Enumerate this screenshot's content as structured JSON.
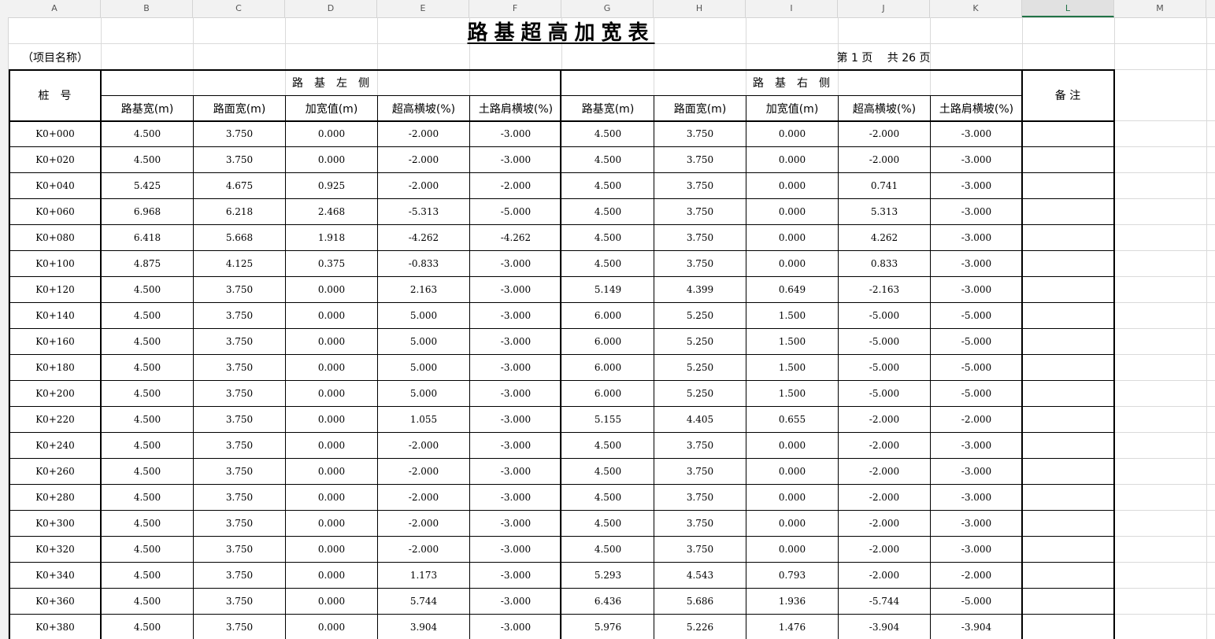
{
  "column_letters": [
    "A",
    "B",
    "C",
    "D",
    "E",
    "F",
    "G",
    "H",
    "I",
    "J",
    "K",
    "L",
    "M"
  ],
  "selected_column": "L",
  "title": "路基超高加宽表",
  "project_name": "（项目名称）",
  "page_info": "第 1 页　 共 26 页",
  "headers": {
    "station": "桩　号",
    "left_group": "路　基　左　侧",
    "right_group": "路　基　右　侧",
    "remarks": "备 注",
    "left_cols": [
      "路基宽(m)",
      "路面宽(m)",
      "加宽值(m)",
      "超高横坡(%)",
      "土路肩横坡(%)"
    ],
    "right_cols": [
      "路基宽(m)",
      "路面宽(m)",
      "加宽值(m)",
      "超高横坡(%)",
      "土路肩横坡(%)"
    ]
  },
  "rows": [
    [
      "K0+000",
      "4.500",
      "3.750",
      "0.000",
      "-2.000",
      "-3.000",
      "4.500",
      "3.750",
      "0.000",
      "-2.000",
      "-3.000",
      ""
    ],
    [
      "K0+020",
      "4.500",
      "3.750",
      "0.000",
      "-2.000",
      "-3.000",
      "4.500",
      "3.750",
      "0.000",
      "-2.000",
      "-3.000",
      ""
    ],
    [
      "K0+040",
      "5.425",
      "4.675",
      "0.925",
      "-2.000",
      "-2.000",
      "4.500",
      "3.750",
      "0.000",
      "0.741",
      "-3.000",
      ""
    ],
    [
      "K0+060",
      "6.968",
      "6.218",
      "2.468",
      "-5.313",
      "-5.000",
      "4.500",
      "3.750",
      "0.000",
      "5.313",
      "-3.000",
      ""
    ],
    [
      "K0+080",
      "6.418",
      "5.668",
      "1.918",
      "-4.262",
      "-4.262",
      "4.500",
      "3.750",
      "0.000",
      "4.262",
      "-3.000",
      ""
    ],
    [
      "K0+100",
      "4.875",
      "4.125",
      "0.375",
      "-0.833",
      "-3.000",
      "4.500",
      "3.750",
      "0.000",
      "0.833",
      "-3.000",
      ""
    ],
    [
      "K0+120",
      "4.500",
      "3.750",
      "0.000",
      "2.163",
      "-3.000",
      "5.149",
      "4.399",
      "0.649",
      "-2.163",
      "-3.000",
      ""
    ],
    [
      "K0+140",
      "4.500",
      "3.750",
      "0.000",
      "5.000",
      "-3.000",
      "6.000",
      "5.250",
      "1.500",
      "-5.000",
      "-5.000",
      ""
    ],
    [
      "K0+160",
      "4.500",
      "3.750",
      "0.000",
      "5.000",
      "-3.000",
      "6.000",
      "5.250",
      "1.500",
      "-5.000",
      "-5.000",
      ""
    ],
    [
      "K0+180",
      "4.500",
      "3.750",
      "0.000",
      "5.000",
      "-3.000",
      "6.000",
      "5.250",
      "1.500",
      "-5.000",
      "-5.000",
      ""
    ],
    [
      "K0+200",
      "4.500",
      "3.750",
      "0.000",
      "5.000",
      "-3.000",
      "6.000",
      "5.250",
      "1.500",
      "-5.000",
      "-5.000",
      ""
    ],
    [
      "K0+220",
      "4.500",
      "3.750",
      "0.000",
      "1.055",
      "-3.000",
      "5.155",
      "4.405",
      "0.655",
      "-2.000",
      "-2.000",
      ""
    ],
    [
      "K0+240",
      "4.500",
      "3.750",
      "0.000",
      "-2.000",
      "-3.000",
      "4.500",
      "3.750",
      "0.000",
      "-2.000",
      "-3.000",
      ""
    ],
    [
      "K0+260",
      "4.500",
      "3.750",
      "0.000",
      "-2.000",
      "-3.000",
      "4.500",
      "3.750",
      "0.000",
      "-2.000",
      "-3.000",
      ""
    ],
    [
      "K0+280",
      "4.500",
      "3.750",
      "0.000",
      "-2.000",
      "-3.000",
      "4.500",
      "3.750",
      "0.000",
      "-2.000",
      "-3.000",
      ""
    ],
    [
      "K0+300",
      "4.500",
      "3.750",
      "0.000",
      "-2.000",
      "-3.000",
      "4.500",
      "3.750",
      "0.000",
      "-2.000",
      "-3.000",
      ""
    ],
    [
      "K0+320",
      "4.500",
      "3.750",
      "0.000",
      "-2.000",
      "-3.000",
      "4.500",
      "3.750",
      "0.000",
      "-2.000",
      "-3.000",
      ""
    ],
    [
      "K0+340",
      "4.500",
      "3.750",
      "0.000",
      "1.173",
      "-3.000",
      "5.293",
      "4.543",
      "0.793",
      "-2.000",
      "-2.000",
      ""
    ],
    [
      "K0+360",
      "4.500",
      "3.750",
      "0.000",
      "5.744",
      "-3.000",
      "6.436",
      "5.686",
      "1.936",
      "-5.744",
      "-5.000",
      ""
    ],
    [
      "K0+380",
      "4.500",
      "3.750",
      "0.000",
      "3.904",
      "-3.000",
      "5.976",
      "5.226",
      "1.476",
      "-3.904",
      "-3.904",
      ""
    ]
  ]
}
